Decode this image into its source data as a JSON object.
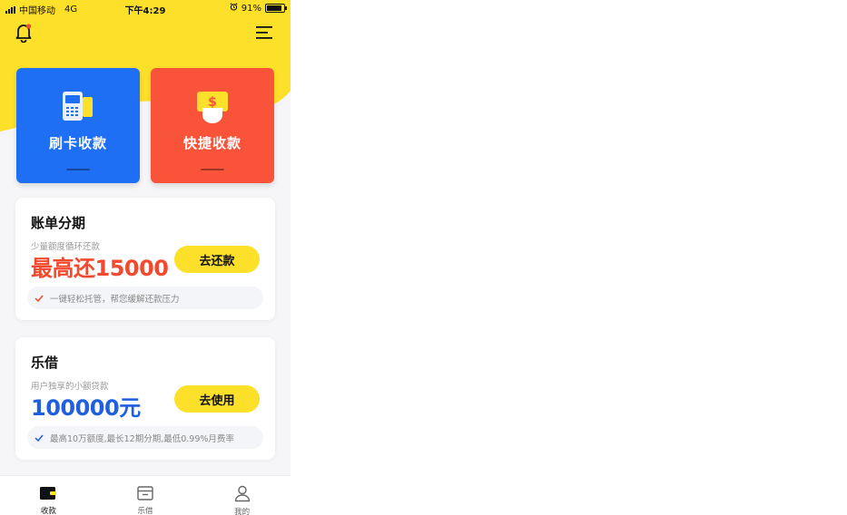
{
  "status_bar": {
    "carrier": "中国移动",
    "network": "4G",
    "time": "下午4:29",
    "battery_percent": "91%",
    "battery_level": 0.91
  },
  "top_bar": {
    "left_icon": "bell-icon",
    "right_icon": "menu-icon",
    "has_notification_dot": true
  },
  "colors": {
    "header_yellow": "#fde02a",
    "swipe_blue": "#1f6ff5",
    "quick_orange": "#f9533a",
    "amount_red": "#f3492e",
    "amount_blue": "#1f5fe0"
  },
  "actions": [
    {
      "label": "刷卡收款",
      "icon": "card-reader-icon"
    },
    {
      "label": "快捷收款",
      "icon": "quick-pay-icon"
    }
  ],
  "products": [
    {
      "title": "账单分期",
      "subtitle": "少量额度循环还款",
      "amount": "最高还15000",
      "button": "去还款",
      "tip": "一键轻松托管，帮您缓解还款压力"
    },
    {
      "title": "乐借",
      "subtitle": "用户独享的小额贷款",
      "amount": "100000元",
      "button": "去使用",
      "tip": "最高10万额度,最长12期分期,最低0.99%月费率"
    }
  ],
  "tabs": [
    {
      "label": "收款",
      "icon": "wallet-icon",
      "active": true
    },
    {
      "label": "乐借",
      "icon": "box-icon",
      "active": false
    },
    {
      "label": "我的",
      "icon": "user-icon",
      "active": false
    }
  ]
}
